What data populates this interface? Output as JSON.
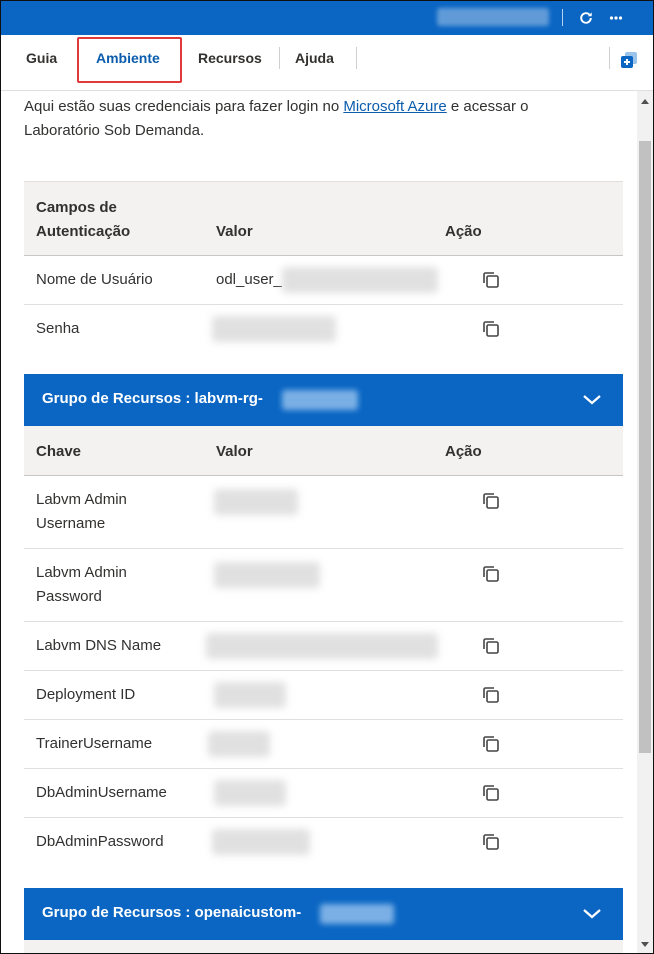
{
  "header": {
    "refresh_icon": "refresh-icon",
    "more_icon": "more-vertical-icon"
  },
  "tabs": [
    {
      "label": "Guia"
    },
    {
      "label": "Ambiente"
    },
    {
      "label": "Recursos"
    },
    {
      "label": "Ajuda"
    }
  ],
  "intro": {
    "before": "Aqui estão suas credenciais para fazer login no ",
    "link": "Microsoft Azure",
    "after": " e acessar o Laboratório Sob Demanda."
  },
  "credentials": {
    "headers": {
      "field_line1": "Campos de",
      "field_line2": "Autenticação",
      "value": "Valor",
      "action": "Ação"
    },
    "rows": [
      {
        "label": "Nome de Usuário",
        "value": "odl_user_"
      },
      {
        "label": "Senha",
        "value": ""
      }
    ]
  },
  "group1": {
    "title": "Grupo de Recursos : labvm-rg-",
    "headers": {
      "key": "Chave",
      "value": "Valor",
      "action": "Ação"
    },
    "rows": [
      {
        "label_line1": "Labvm Admin",
        "label_line2": "Username"
      },
      {
        "label_line1": "Labvm Admin",
        "label_line2": "Password"
      },
      {
        "label": "Labvm DNS Name"
      },
      {
        "label": "Deployment ID"
      },
      {
        "label": "TrainerUsername"
      },
      {
        "label": "DbAdminUsername"
      },
      {
        "label": "DbAdminPassword"
      }
    ]
  },
  "group2": {
    "title": "Grupo de Recursos : openaicustom-"
  },
  "colors": {
    "brand_blue": "#0b66c3",
    "active_tab": "#0b5cad",
    "highlight_red": "#e03a3a"
  }
}
